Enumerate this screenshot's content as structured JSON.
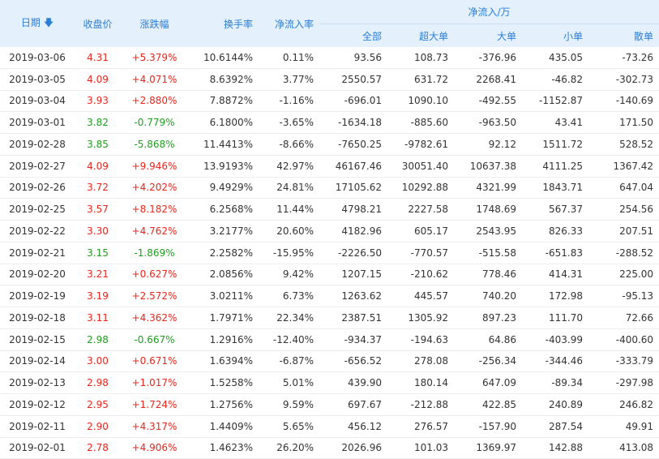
{
  "headers": {
    "date": "日期",
    "close": "收盘价",
    "change": "涨跌幅",
    "turnover": "换手率",
    "net_ratio": "净流入率",
    "net_inflow_group": "净流入/万",
    "all": "全部",
    "super_large": "超大单",
    "large": "大单",
    "small": "小单",
    "retail": "散单"
  },
  "colors": {
    "up": "#e8261c",
    "down": "#1f9c1f",
    "header_bg": "#e4f0fb",
    "header_text": "#2a7ed6"
  },
  "rows": [
    {
      "date": "2019-03-06",
      "close": "4.31",
      "change": "+5.379%",
      "turnover": "10.6144%",
      "ratio": "0.11%",
      "all": "93.56",
      "super": "108.73",
      "large": "-376.96",
      "small": "435.05",
      "retail": "-73.26",
      "dir": "up"
    },
    {
      "date": "2019-03-05",
      "close": "4.09",
      "change": "+4.071%",
      "turnover": "8.6392%",
      "ratio": "3.77%",
      "all": "2550.57",
      "super": "631.72",
      "large": "2268.41",
      "small": "-46.82",
      "retail": "-302.73",
      "dir": "up"
    },
    {
      "date": "2019-03-04",
      "close": "3.93",
      "change": "+2.880%",
      "turnover": "7.8872%",
      "ratio": "-1.16%",
      "all": "-696.01",
      "super": "1090.10",
      "large": "-492.55",
      "small": "-1152.87",
      "retail": "-140.69",
      "dir": "up"
    },
    {
      "date": "2019-03-01",
      "close": "3.82",
      "change": "-0.779%",
      "turnover": "6.1800%",
      "ratio": "-3.65%",
      "all": "-1634.18",
      "super": "-885.60",
      "large": "-963.50",
      "small": "43.41",
      "retail": "171.50",
      "dir": "down"
    },
    {
      "date": "2019-02-28",
      "close": "3.85",
      "change": "-5.868%",
      "turnover": "11.4413%",
      "ratio": "-8.66%",
      "all": "-7650.25",
      "super": "-9782.61",
      "large": "92.12",
      "small": "1511.72",
      "retail": "528.52",
      "dir": "down"
    },
    {
      "date": "2019-02-27",
      "close": "4.09",
      "change": "+9.946%",
      "turnover": "13.9193%",
      "ratio": "42.97%",
      "all": "46167.46",
      "super": "30051.40",
      "large": "10637.38",
      "small": "4111.25",
      "retail": "1367.42",
      "dir": "up"
    },
    {
      "date": "2019-02-26",
      "close": "3.72",
      "change": "+4.202%",
      "turnover": "9.4929%",
      "ratio": "24.81%",
      "all": "17105.62",
      "super": "10292.88",
      "large": "4321.99",
      "small": "1843.71",
      "retail": "647.04",
      "dir": "up"
    },
    {
      "date": "2019-02-25",
      "close": "3.57",
      "change": "+8.182%",
      "turnover": "6.2568%",
      "ratio": "11.44%",
      "all": "4798.21",
      "super": "2227.58",
      "large": "1748.69",
      "small": "567.37",
      "retail": "254.56",
      "dir": "up"
    },
    {
      "date": "2019-02-22",
      "close": "3.30",
      "change": "+4.762%",
      "turnover": "3.2177%",
      "ratio": "20.60%",
      "all": "4182.96",
      "super": "605.17",
      "large": "2543.95",
      "small": "826.33",
      "retail": "207.51",
      "dir": "up"
    },
    {
      "date": "2019-02-21",
      "close": "3.15",
      "change": "-1.869%",
      "turnover": "2.2582%",
      "ratio": "-15.95%",
      "all": "-2226.50",
      "super": "-770.57",
      "large": "-515.58",
      "small": "-651.83",
      "retail": "-288.52",
      "dir": "down"
    },
    {
      "date": "2019-02-20",
      "close": "3.21",
      "change": "+0.627%",
      "turnover": "2.0856%",
      "ratio": "9.42%",
      "all": "1207.15",
      "super": "-210.62",
      "large": "778.46",
      "small": "414.31",
      "retail": "225.00",
      "dir": "up"
    },
    {
      "date": "2019-02-19",
      "close": "3.19",
      "change": "+2.572%",
      "turnover": "3.0211%",
      "ratio": "6.73%",
      "all": "1263.62",
      "super": "445.57",
      "large": "740.20",
      "small": "172.98",
      "retail": "-95.13",
      "dir": "up"
    },
    {
      "date": "2019-02-18",
      "close": "3.11",
      "change": "+4.362%",
      "turnover": "1.7971%",
      "ratio": "22.34%",
      "all": "2387.51",
      "super": "1305.92",
      "large": "897.23",
      "small": "111.70",
      "retail": "72.66",
      "dir": "up"
    },
    {
      "date": "2019-02-15",
      "close": "2.98",
      "change": "-0.667%",
      "turnover": "1.2916%",
      "ratio": "-12.40%",
      "all": "-934.37",
      "super": "-194.63",
      "large": "64.86",
      "small": "-403.99",
      "retail": "-400.60",
      "dir": "down"
    },
    {
      "date": "2019-02-14",
      "close": "3.00",
      "change": "+0.671%",
      "turnover": "1.6394%",
      "ratio": "-6.87%",
      "all": "-656.52",
      "super": "278.08",
      "large": "-256.34",
      "small": "-344.46",
      "retail": "-333.79",
      "dir": "up"
    },
    {
      "date": "2019-02-13",
      "close": "2.98",
      "change": "+1.017%",
      "turnover": "1.5258%",
      "ratio": "5.01%",
      "all": "439.90",
      "super": "180.14",
      "large": "647.09",
      "small": "-89.34",
      "retail": "-297.98",
      "dir": "up"
    },
    {
      "date": "2019-02-12",
      "close": "2.95",
      "change": "+1.724%",
      "turnover": "1.2756%",
      "ratio": "9.59%",
      "all": "697.67",
      "super": "-212.88",
      "large": "422.85",
      "small": "240.89",
      "retail": "246.82",
      "dir": "up"
    },
    {
      "date": "2019-02-11",
      "close": "2.90",
      "change": "+4.317%",
      "turnover": "1.4409%",
      "ratio": "5.65%",
      "all": "456.12",
      "super": "276.57",
      "large": "-157.90",
      "small": "287.54",
      "retail": "49.91",
      "dir": "up"
    },
    {
      "date": "2019-02-01",
      "close": "2.78",
      "change": "+4.906%",
      "turnover": "1.4623%",
      "ratio": "26.20%",
      "all": "2026.96",
      "super": "101.03",
      "large": "1369.97",
      "small": "142.88",
      "retail": "413.08",
      "dir": "up"
    }
  ]
}
